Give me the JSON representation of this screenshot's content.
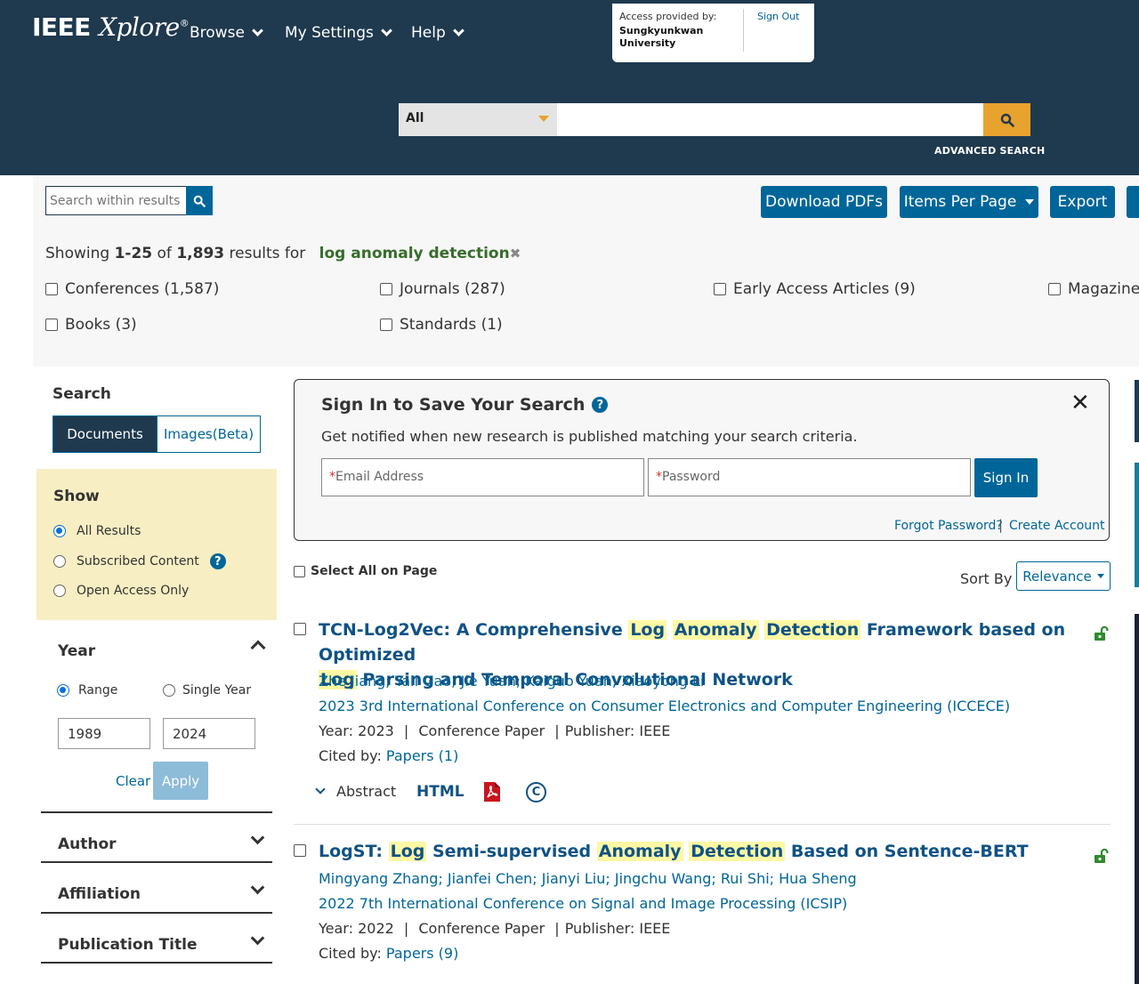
{
  "header": {
    "logo_ieee": "IEEE",
    "logo_xplore": "Xplore",
    "logo_reg": "®",
    "nav": [
      {
        "label": "Browse"
      },
      {
        "label": "My Settings"
      },
      {
        "label": "Help"
      }
    ],
    "access": {
      "label": "Access provided by:",
      "institution": "Sungkyunkwan University",
      "sign_out": "Sign Out"
    },
    "search": {
      "scope": "All",
      "query_value": "",
      "advanced_label": "ADVANCED SEARCH"
    }
  },
  "toolbar": {
    "within_placeholder": "Search within results",
    "download_pdfs": "Download PDFs",
    "items_per_page": "Items Per Page",
    "export": "Export"
  },
  "results_summary": {
    "showing_prefix": "Showing",
    "range": "1-25",
    "of": "of",
    "total": "1,893",
    "results_for": "results for",
    "query": "log anomaly detection",
    "clear_symbol": "✖"
  },
  "content_type_facets": [
    {
      "label": "Conferences (1,587)"
    },
    {
      "label": "Journals (287)"
    },
    {
      "label": "Early Access Articles (9)"
    },
    {
      "label": "Magazines"
    },
    {
      "label": "Books (3)"
    },
    {
      "label": "Standards (1)"
    }
  ],
  "sidebar": {
    "search_title": "Search",
    "tab_documents": "Documents",
    "tab_images": "Images(Beta)",
    "show_title": "Show",
    "show_options": [
      {
        "label": "All Results",
        "selected": true
      },
      {
        "label": "Subscribed Content",
        "selected": false
      },
      {
        "label": "Open Access Only",
        "selected": false
      }
    ],
    "year": {
      "title": "Year",
      "range_label": "Range",
      "single_label": "Single Year",
      "mode": "Range",
      "from": "1989",
      "to": "2024",
      "clear": "Clear",
      "apply": "Apply"
    },
    "accordions": [
      {
        "label": "Author"
      },
      {
        "label": "Affiliation"
      },
      {
        "label": "Publication Title"
      }
    ]
  },
  "signin_panel": {
    "title": "Sign In to Save Your Search",
    "subtitle": "Get notified when new research is published matching your search criteria.",
    "close": "✕",
    "email_placeholder": "Email Address",
    "password_placeholder": "Password",
    "required_mark": "*",
    "sign_in": "Sign In",
    "forgot": "Forgot Password?",
    "separator": "|",
    "create": "Create Account"
  },
  "results_controls": {
    "select_all": "Select All on Page",
    "sort_by": "Sort By",
    "sort_value": "Relevance"
  },
  "results": [
    {
      "title_line1": [
        {
          "t": "TCN-Log2Vec: A Comprehensive ",
          "hl": false
        },
        {
          "t": "Log",
          "hl": true
        },
        {
          "t": " ",
          "hl": false
        },
        {
          "t": "Anomaly",
          "hl": true
        },
        {
          "t": " ",
          "hl": false
        },
        {
          "t": "Detection",
          "hl": true
        },
        {
          "t": " Framework based on Optimized",
          "hl": false
        }
      ],
      "title_line2": [
        {
          "t": "Log",
          "hl": true
        },
        {
          "t": " Parsing and Temporal Convolutional Network",
          "hl": false
        }
      ],
      "authors": "Zhe Jiang; Yali Gao; Jie Yuan; Kaiguo Yuan; Xiaoyong Li",
      "venue": "2023 3rd International Conference on Consumer Electronics and Computer Engineering (ICCECE)",
      "year_label": "Year:",
      "year": "2023",
      "type": "Conference Paper",
      "publisher_label": "Publisher:",
      "publisher": "IEEE",
      "cited_label": "Cited by:",
      "cited": "Papers (1)",
      "abstract": "Abstract",
      "html": "HTML",
      "rights_symbol": "C",
      "open_access": true
    },
    {
      "title_line1": [
        {
          "t": "LogST: ",
          "hl": false
        },
        {
          "t": "Log",
          "hl": true
        },
        {
          "t": " Semi-supervised ",
          "hl": false
        },
        {
          "t": "Anomaly",
          "hl": true
        },
        {
          "t": " ",
          "hl": false
        },
        {
          "t": "Detection",
          "hl": true
        },
        {
          "t": " Based on Sentence-BERT",
          "hl": false
        }
      ],
      "authors": "Mingyang Zhang; Jianfei Chen; Jianyi Liu; Jingchu Wang; Rui Shi; Hua Sheng",
      "venue": "2022 7th International Conference on Signal and Image Processing (ICSIP)",
      "year_label": "Year:",
      "year": "2022",
      "type": "Conference Paper",
      "publisher_label": "Publisher:",
      "publisher": "IEEE",
      "cited_label": "Cited by:",
      "cited": "Papers (9)",
      "open_access": true
    }
  ],
  "colors": {
    "header_bg": "#1f394e",
    "primary": "#006699",
    "accent": "#e8a22e",
    "highlight": "#fdf8a4",
    "query_green": "#376d2b",
    "show_box": "#f8eec3"
  }
}
